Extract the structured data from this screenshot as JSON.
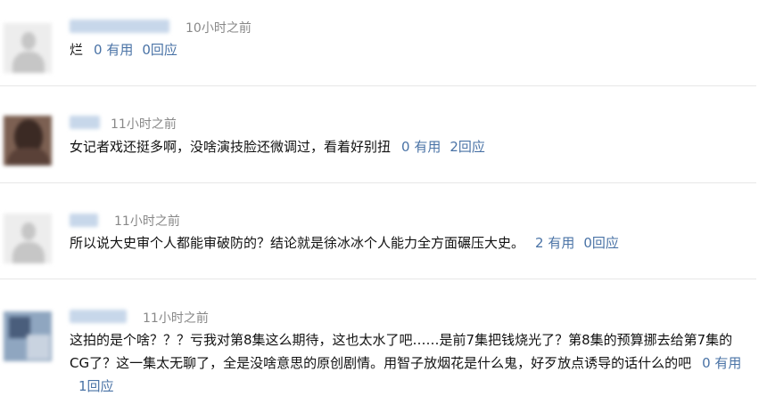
{
  "comments": [
    {
      "time": "10小时之前",
      "text": "烂",
      "likes": "0 有用",
      "replies": "0回应"
    },
    {
      "time": "11小时之前",
      "text": "女记者戏还挺多啊，没啥演技脸还微调过，看着好别扭",
      "likes": "0 有用",
      "replies": "2回应"
    },
    {
      "time": "11小时之前",
      "text": "所以说大史审个人都能审破防的？结论就是徐冰冰个人能力全方面碾压大史。",
      "likes": "2 有用",
      "replies": "0回应"
    },
    {
      "time": "11小时之前",
      "text": "这拍的是个啥？？？亏我对第8集这么期待，这也太水了吧……是前7集把钱烧光了？第8集的预算挪去给第7集的CG了？这一集太无聊了，全是没啥意思的原创剧情。用智子放烟花是什么鬼，好歹放点诱导的话什么的吧",
      "likes": "0 有用",
      "replies": "1回应"
    }
  ],
  "colors": {
    "action": "#4a73a6",
    "time": "#888888",
    "divider": "#e7e7e7"
  }
}
